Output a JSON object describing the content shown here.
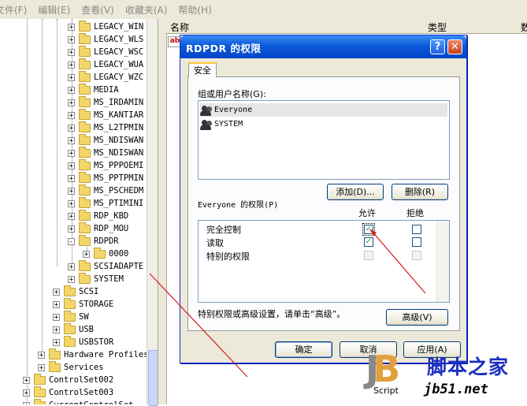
{
  "menubar": [
    "文件(F)",
    "编辑(E)",
    "查看(V)",
    "收藏夹(A)",
    "帮助(H)"
  ],
  "tree": {
    "items": [
      {
        "label": "LEGACY_WIN",
        "exp": "+"
      },
      {
        "label": "LEGACY_WLS",
        "exp": "+"
      },
      {
        "label": "LEGACY_WSC",
        "exp": "+"
      },
      {
        "label": "LEGACY_WUA",
        "exp": "+"
      },
      {
        "label": "LEGACY_WZC",
        "exp": "+"
      },
      {
        "label": "MEDIA",
        "exp": "+"
      },
      {
        "label": "MS_IRDAMIN",
        "exp": "+"
      },
      {
        "label": "MS_KANTIAR",
        "exp": "+"
      },
      {
        "label": "MS_L2TPMIN",
        "exp": "+"
      },
      {
        "label": "MS_NDISWAN",
        "exp": "+"
      },
      {
        "label": "MS_NDISWAN",
        "exp": "+"
      },
      {
        "label": "MS_PPPOEMI",
        "exp": "+"
      },
      {
        "label": "MS_PPTPMIN",
        "exp": "+"
      },
      {
        "label": "MS_PSCHEDM",
        "exp": "+"
      },
      {
        "label": "MS_PTIMINI",
        "exp": "+"
      },
      {
        "label": "RDP_KBD",
        "exp": "+"
      },
      {
        "label": "RDP_MOU",
        "exp": "+"
      },
      {
        "label": "RDPDR",
        "exp": "-"
      },
      {
        "label": "0000",
        "exp": "+"
      },
      {
        "label": "SCSIADAPTE",
        "exp": "+"
      },
      {
        "label": "SYSTEM",
        "exp": "+"
      },
      {
        "label": "SCSI",
        "exp": "+"
      },
      {
        "label": "STORAGE",
        "exp": "+"
      },
      {
        "label": "SW",
        "exp": "+"
      },
      {
        "label": "USB",
        "exp": "+"
      },
      {
        "label": "USBSTOR",
        "exp": "+"
      },
      {
        "label": "Hardware Profiles",
        "exp": "+"
      },
      {
        "label": "Services",
        "exp": "+"
      },
      {
        "label": "ControlSet002",
        "exp": "+"
      },
      {
        "label": "ControlSet003",
        "exp": "+"
      },
      {
        "label": "CurrentControlSet",
        "exp": "+"
      }
    ]
  },
  "list": {
    "col_name": "名称",
    "col_type": "类型",
    "col_data": "数",
    "icon_text": "ab"
  },
  "dialog": {
    "title": "RDPDR 的权限",
    "help_glyph": "?",
    "close_glyph": "✕",
    "tab": "安全",
    "group_label": "组或用户名称(G):",
    "users": [
      "Everyone",
      "SYSTEM"
    ],
    "add_button": "添加(D)...",
    "remove_button": "删除(R)",
    "perm_label": "Everyone 的权限(P)",
    "allow_header": "允许",
    "deny_header": "拒绝",
    "permissions": [
      {
        "name": "完全控制",
        "allow": "✓",
        "deny": ""
      },
      {
        "name": "读取",
        "allow": "✓",
        "deny": ""
      },
      {
        "name": "特别的权限",
        "allow": "",
        "deny": ""
      }
    ],
    "advanced_hint": "特别权限或高级设置，请单击“高级”。",
    "advanced_button": "高级(V)",
    "ok_button": "确定",
    "cancel_button": "取消",
    "apply_button": "应用(A)"
  },
  "watermark": {
    "jb_j": "J",
    "jb_b": "B",
    "script": "Script",
    "cn": "脚本之家",
    "url": "jb51.net"
  },
  "colors": {
    "title_blue": "#0a5ad8",
    "check_green": "#21a121",
    "arrow_red": "#d41c1c",
    "watermark_blue": "#1c2fbf",
    "watermark_orange": "#e39f3d"
  }
}
